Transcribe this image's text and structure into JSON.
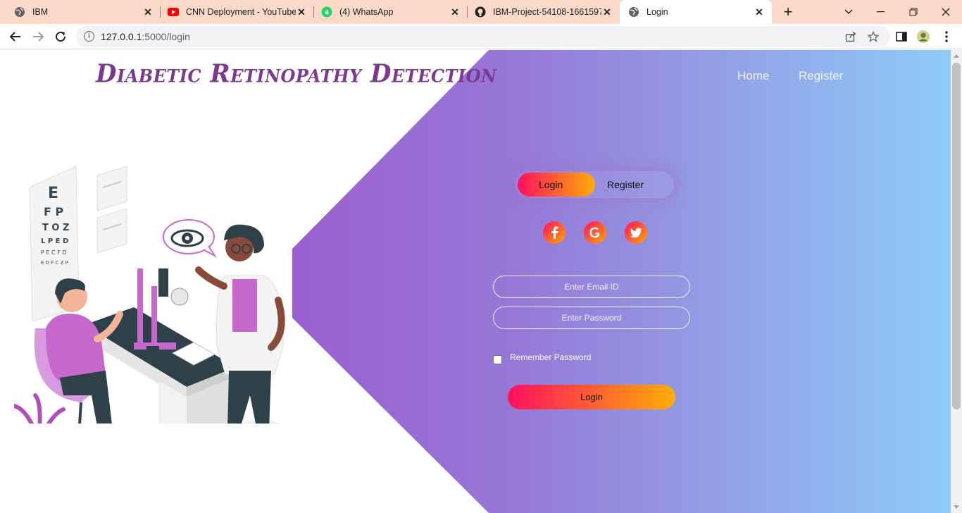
{
  "browser": {
    "tabs": [
      {
        "title": "IBM",
        "icon": "globe-icon"
      },
      {
        "title": "CNN Deployment - YouTube",
        "icon": "youtube-icon"
      },
      {
        "title": "(4) WhatsApp",
        "icon": "whatsapp-icon"
      },
      {
        "title": "IBM-Project-54108-1661597…",
        "icon": "github-icon"
      },
      {
        "title": "Login",
        "icon": "globe-icon"
      }
    ],
    "address": {
      "host": "127.0.0.1",
      "path": ":5000/login"
    }
  },
  "header": {
    "brand": "Diabetic Retinopathy Detection",
    "nav": [
      "Home",
      "Register"
    ]
  },
  "login_card": {
    "toggle": {
      "active": "Login",
      "inactive": "Register"
    },
    "social_icons": [
      "facebook-icon",
      "google-icon",
      "twitter-icon"
    ],
    "email_placeholder": "Enter Email ID",
    "password_placeholder": "Enter Password",
    "remember_label": "Remember Password",
    "submit_label": "Login"
  },
  "colors": {
    "brand": "#7b3a8e",
    "gradient_start": "#ff105f",
    "gradient_end": "#ffad06",
    "panel_left": "#9b5fcf",
    "panel_right": "#8ecbfb",
    "tabbar": "#fbd9c8"
  }
}
